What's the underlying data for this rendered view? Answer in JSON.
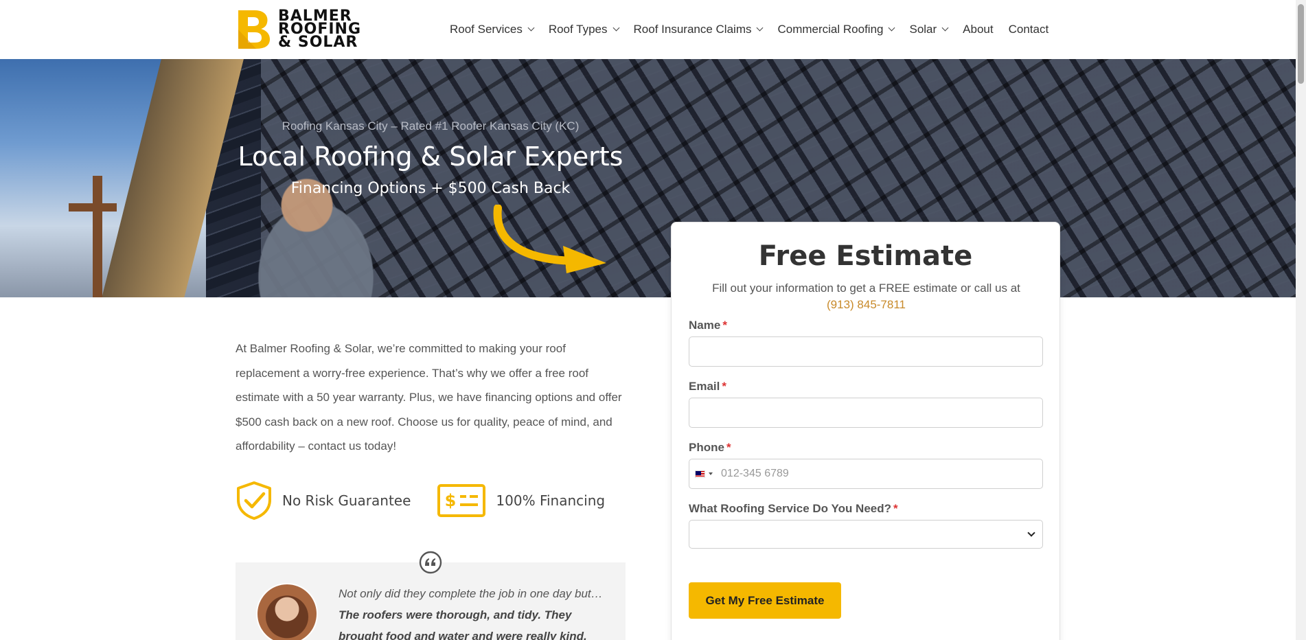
{
  "brand": {
    "logo_mark": "B",
    "logo_lines": [
      "BALMER",
      "ROOFING",
      "& SOLAR"
    ],
    "accent_color": "#f5b800"
  },
  "nav": {
    "items": [
      {
        "label": "Roof Services",
        "has_dropdown": true
      },
      {
        "label": "Roof Types",
        "has_dropdown": true
      },
      {
        "label": "Roof Insurance Claims",
        "has_dropdown": true
      },
      {
        "label": "Commercial Roofing",
        "has_dropdown": true
      },
      {
        "label": "Solar",
        "has_dropdown": true
      },
      {
        "label": "About",
        "has_dropdown": false
      },
      {
        "label": "Contact",
        "has_dropdown": false
      }
    ]
  },
  "hero": {
    "eyebrow": "Roofing Kansas City – Rated #1 Roofer Kansas City (KC)",
    "title": "Local Roofing & Solar Experts",
    "subtitle": "Financing Options + $500 Cash Back"
  },
  "intro": {
    "text": "At Balmer Roofing & Solar, we’re committed to making your roof replacement a worry-free experience. That’s why we offer a free roof estimate with a 50 year warranty. Plus, we have financing options and offer $500 cash back on a new roof. Choose us for quality, peace of mind, and affordability – contact us today!"
  },
  "features": [
    {
      "icon": "shield-check-icon",
      "label": "No Risk Guarantee"
    },
    {
      "icon": "dollar-card-icon",
      "label": "100% Financing"
    }
  ],
  "testimonial": {
    "quote_plain": "Not only did they complete the job in one day but… ",
    "quote_bold": "The roofers were thorough, and tidy. They brought food and water and were really kind."
  },
  "form": {
    "title": "Free Estimate",
    "description": "Fill out your information to get a FREE estimate or call us at",
    "phone_number": "(913) 845-7811",
    "required_marker": "*",
    "fields": {
      "name_label": "Name",
      "name_value": "",
      "email_label": "Email",
      "email_value": "",
      "phone_label": "Phone",
      "phone_placeholder": "012-345 6789",
      "service_label": "What Roofing Service Do You Need?",
      "service_value": ""
    },
    "submit_label": "Get My Free Estimate"
  }
}
